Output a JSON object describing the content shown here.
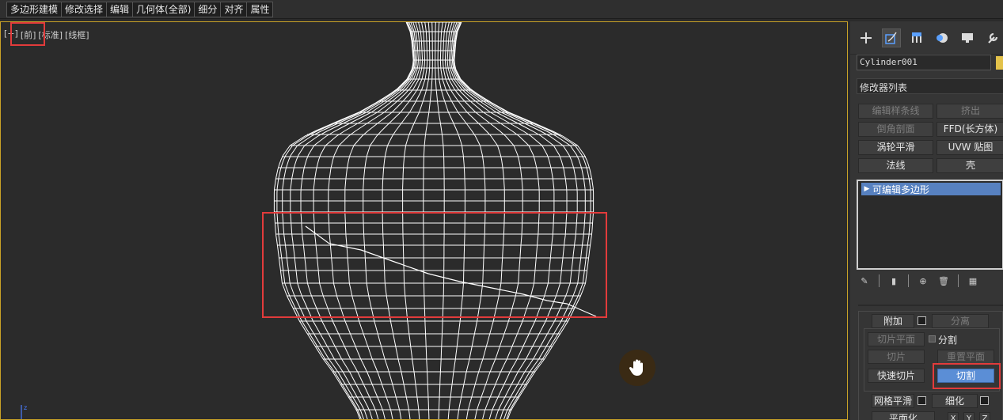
{
  "menu": [
    "多边形建模",
    "修改选择",
    "编辑",
    "几何体(全部)",
    "细分",
    "对齐",
    "属性"
  ],
  "viewport": {
    "labels": [
      "[+]",
      "[前]",
      "[标准]",
      "[线框]"
    ]
  },
  "panel": {
    "tabs": [
      "create-icon",
      "modify-icon",
      "hierarchy-icon",
      "motion-icon",
      "display-icon",
      "utilities-icon"
    ],
    "object_name": "Cylinder001",
    "object_color": "#e3c24a",
    "modifier_list": "修改器列表",
    "modifier_buttons": [
      "编辑样条线",
      "挤出",
      "倒角剖面",
      "FFD(长方体)",
      "涡轮平滑",
      "UVW 贴图",
      "法线",
      "壳"
    ],
    "stack_item": "可编辑多边形",
    "attach": "附加",
    "detach": "分离",
    "slice_plane": "切片平面",
    "split": "分割",
    "slice": "切片",
    "reset_plane": "重置平面",
    "quick_slice": "快速切片",
    "cut": "切割",
    "meshsmooth": "网格平滑",
    "tessellate": "细化",
    "planarize": "平面化",
    "xyz": [
      "X",
      "Y",
      "Z"
    ]
  }
}
